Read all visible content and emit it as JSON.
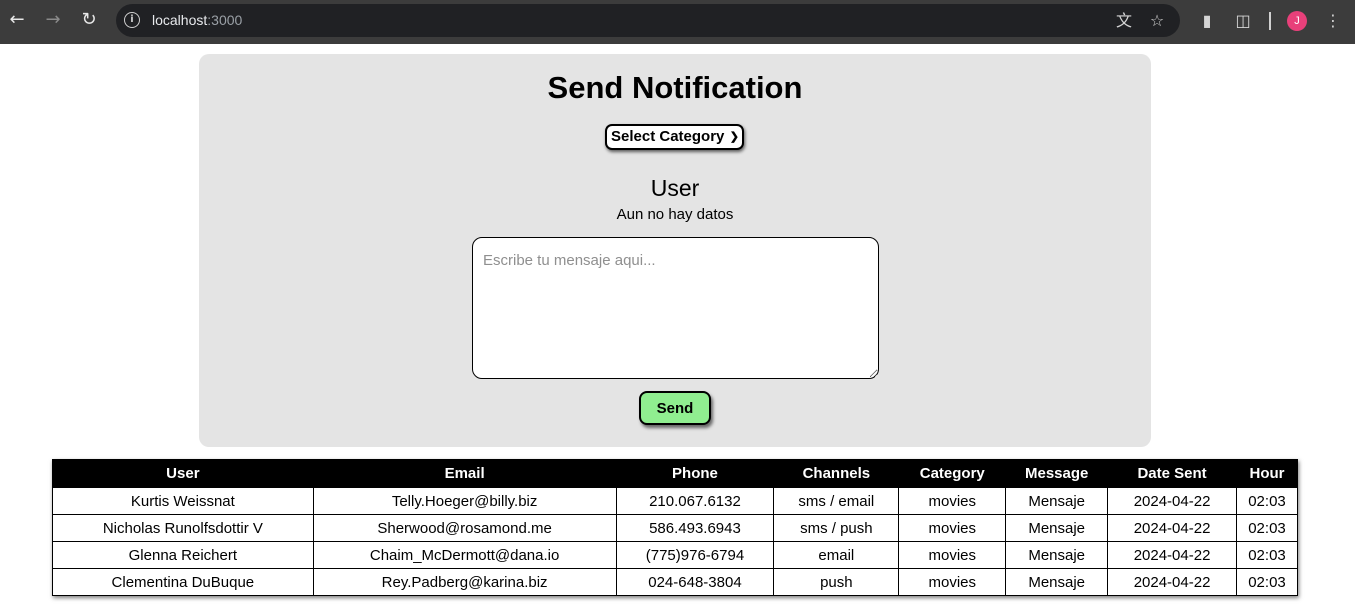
{
  "browser": {
    "url_host": "localhost",
    "url_port": ":3000",
    "avatar_letter": "J"
  },
  "panel": {
    "title": "Send Notification",
    "category_select": "Select Category",
    "user_heading": "User",
    "no_data": "Aun no hay datos",
    "message_placeholder": "Escribe tu mensaje aqui...",
    "send_label": "Send"
  },
  "table": {
    "headers": [
      "User",
      "Email",
      "Phone",
      "Channels",
      "Category",
      "Message",
      "Date Sent",
      "Hour"
    ],
    "rows": [
      [
        "Kurtis Weissnat",
        "Telly.Hoeger@billy.biz",
        "210.067.6132",
        "sms / email",
        "movies",
        "Mensaje",
        "2024-04-22",
        "02:03"
      ],
      [
        "Nicholas Runolfsdottir V",
        "Sherwood@rosamond.me",
        "586.493.6943",
        "sms / push",
        "movies",
        "Mensaje",
        "2024-04-22",
        "02:03"
      ],
      [
        "Glenna Reichert",
        "Chaim_McDermott@dana.io",
        "(775)976-6794",
        "email",
        "movies",
        "Mensaje",
        "2024-04-22",
        "02:03"
      ],
      [
        "Clementina DuBuque",
        "Rey.Padberg@karina.biz",
        "024-648-3804",
        "push",
        "movies",
        "Mensaje",
        "2024-04-22",
        "02:03"
      ]
    ]
  },
  "colors": {
    "chrome_bg": "#3c3c3c",
    "panel_bg": "#e4e4e4",
    "send_bg": "#90ee90",
    "table_header_bg": "#000000"
  }
}
